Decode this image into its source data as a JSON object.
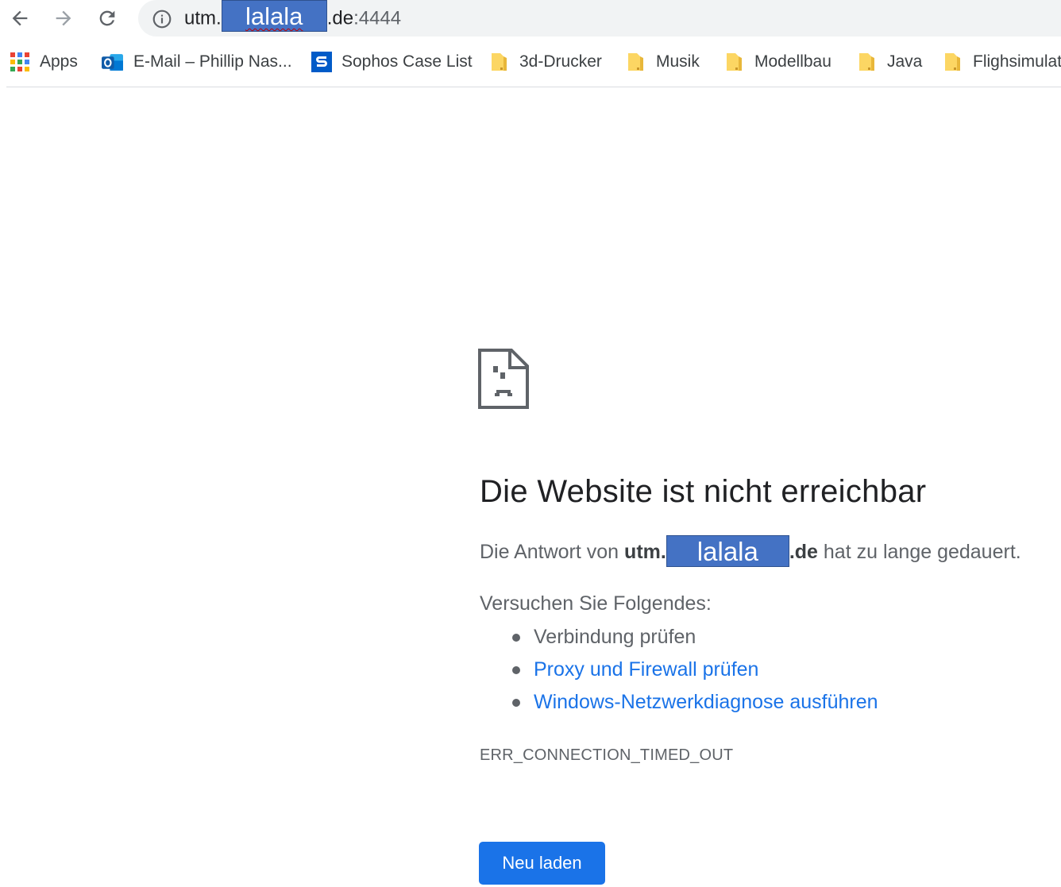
{
  "toolbar": {
    "url_host_prefix": "utm.",
    "url_redacted": "lalala",
    "url_suffix": ".de",
    "url_port": ":4444"
  },
  "bookmarks": [
    {
      "label": "Apps",
      "icon": "apps-grid-icon"
    },
    {
      "label": "E-Mail – Phillip Nas...",
      "icon": "outlook-icon"
    },
    {
      "label": "Sophos Case List",
      "icon": "sophos-icon"
    },
    {
      "label": "3d-Drucker",
      "icon": "folder-icon"
    },
    {
      "label": "Musik",
      "icon": "folder-icon"
    },
    {
      "label": "Modellbau",
      "icon": "folder-icon"
    },
    {
      "label": "Java",
      "icon": "folder-icon"
    },
    {
      "label": "Flighsimulat",
      "icon": "folder-icon"
    }
  ],
  "error": {
    "icon": "sad-page-icon",
    "title": "Die Website ist nicht erreichbar",
    "desc_prefix": "Die Antwort von",
    "host_prefix": "utm.",
    "host_redacted": "lalala",
    "host_suffix": ".de",
    "desc_suffix": "hat zu lange gedauert.",
    "suggestions_heading": "Versuchen Sie Folgendes:",
    "suggestions": [
      {
        "text": "Verbindung prüfen",
        "link": false
      },
      {
        "text": "Proxy und Firewall prüfen",
        "link": true
      },
      {
        "text": "Windows-Netzwerkdiagnose ausführen",
        "link": true
      }
    ],
    "code": "ERR_CONNECTION_TIMED_OUT",
    "reload_label": "Neu laden"
  },
  "colors": {
    "accent": "#1a73e8",
    "redaction": "#4472c4",
    "omnibox": "#f1f3f4",
    "folder": "#fcd663"
  }
}
